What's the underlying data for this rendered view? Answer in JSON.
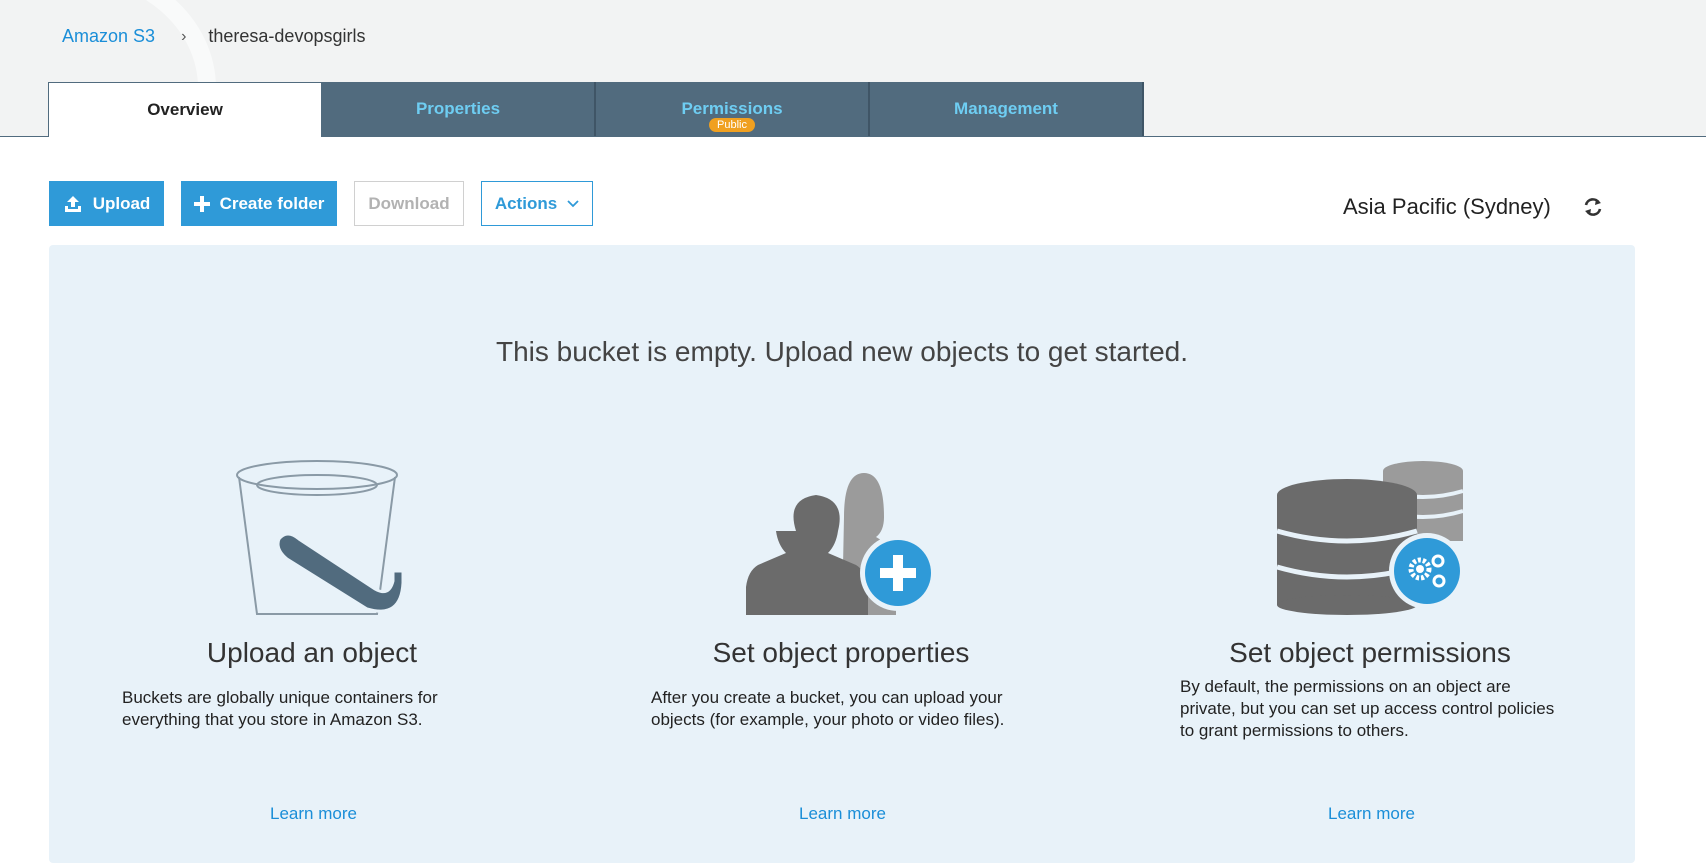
{
  "breadcrumb": {
    "root": "Amazon S3",
    "separator": "›",
    "current": "theresa-devopsgirls"
  },
  "tabs": [
    {
      "label": "Overview"
    },
    {
      "label": "Properties"
    },
    {
      "label": "Permissions",
      "badge": "Public"
    },
    {
      "label": "Management"
    }
  ],
  "toolbar": {
    "upload": "Upload",
    "create_folder": "Create folder",
    "download": "Download",
    "actions": "Actions"
  },
  "region": "Asia Pacific (Sydney)",
  "empty": {
    "message": "This bucket is empty. Upload new objects to get started.",
    "cards": [
      {
        "title": "Upload an object",
        "text": "Buckets are globally unique containers for everything that you store in Amazon S3.",
        "link": "Learn more"
      },
      {
        "title": "Set object properties",
        "text": "After you create a bucket, you can upload your objects (for example, your photo or video files).",
        "link": "Learn more"
      },
      {
        "title": "Set object permissions",
        "text": "By default, the permissions on an object are private, but you can set up access control policies to grant permissions to others.",
        "link": "Learn more"
      }
    ]
  },
  "colors": {
    "accent": "#2f9ad8",
    "tab_bg": "#516b7e",
    "tab_text": "#6ecdf2",
    "panel_bg": "#e8f2f9",
    "badge": "#f0a020"
  },
  "icons": [
    "upload-icon",
    "plus-icon",
    "chevron-down-icon",
    "refresh-icon",
    "bucket-icon",
    "users-add-icon",
    "database-gear-icon"
  ]
}
